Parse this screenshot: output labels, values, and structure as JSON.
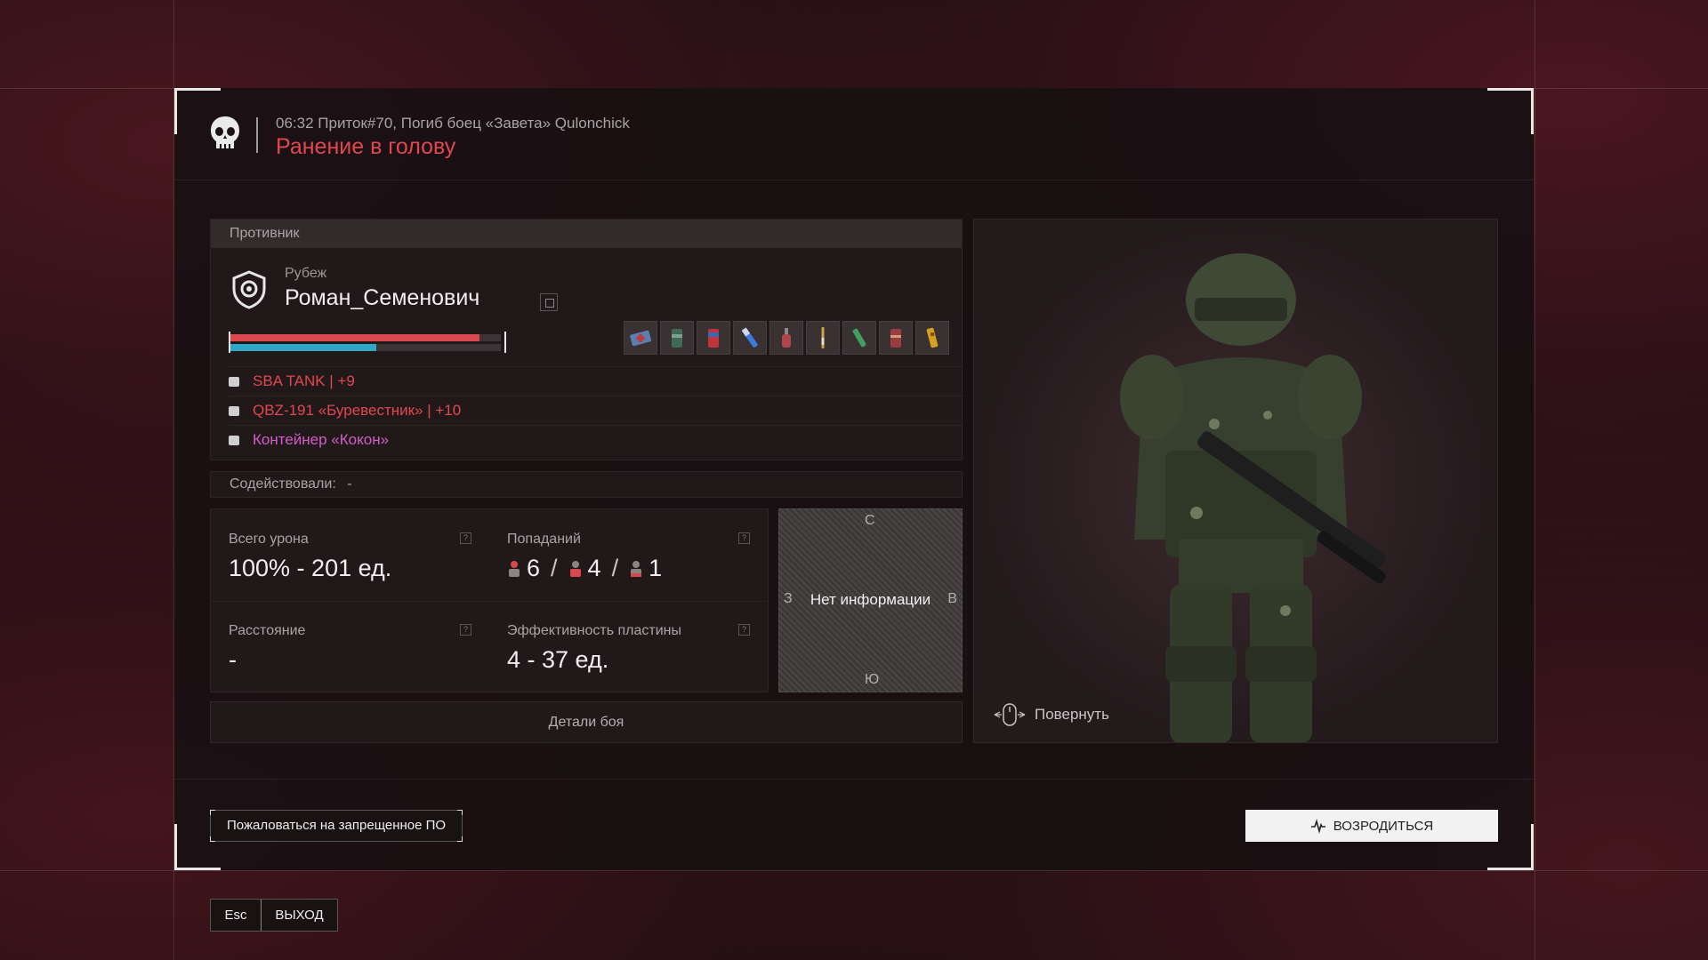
{
  "header": {
    "subtitle": "06:32 Приток#70, Погиб боец «Завета» Qulonchick",
    "title": "Ранение в голову"
  },
  "enemy": {
    "section_label": "Противник",
    "faction": "Рубеж",
    "name": "Роман_Семенович",
    "health_fraction": 0.92,
    "armor_fraction": 0.54,
    "gear": [
      {
        "text": "SBA TANK | +9",
        "color": "#e0484f"
      },
      {
        "text": "QBZ-191 «Буревестник» | +10",
        "color": "#e0484f"
      },
      {
        "text": "Контейнер «Кокон»",
        "color": "#d35ec8"
      }
    ],
    "belt_items": [
      "medkit-icon",
      "canister-icon",
      "battery-icon",
      "syringe-icon",
      "bottle-icon",
      "injector-icon",
      "bottle-green-icon",
      "can-icon",
      "ammo-icon"
    ]
  },
  "assist": {
    "label": "Содействовали:",
    "value": "-"
  },
  "stats": {
    "damage_label": "Всего урона",
    "damage_value": "100% - 201 ед.",
    "hits_label": "Попаданий",
    "hits": [
      "6",
      "4",
      "1"
    ],
    "distance_label": "Расстояние",
    "distance_value": "-",
    "plate_label": "Эффективность пластины",
    "plate_value": "4 - 37 ед."
  },
  "compass": {
    "north": "С",
    "south": "Ю",
    "west": "З",
    "east": "В",
    "center": "Нет информации"
  },
  "details_button": "Детали боя",
  "model_view": {
    "rotate_label": "Повернуть"
  },
  "footer": {
    "report_button": "Пожаловаться на запрещенное ПО",
    "respawn_button": "ВОЗРОДИТЬСЯ"
  },
  "exit": {
    "key": "Esc",
    "label": "ВЫХОД"
  }
}
